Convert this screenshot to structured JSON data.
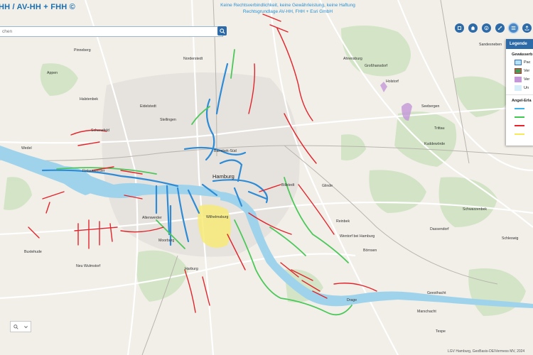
{
  "header": {
    "title": "HH / AV-HH + FHH ©",
    "disclaimer_line1": "Keine Rechtsverbindlichkeit, keine Gewährleistung, keine Haftung",
    "disclaimer_line2": "Rechtsgrundlage AV-HH, FHH + Esri GmbH"
  },
  "search": {
    "placeholder": "chen"
  },
  "toolbar": {
    "buttons": [
      "layers-icon",
      "home-icon",
      "info-icon",
      "share-icon",
      "legend-icon",
      "export-icon"
    ]
  },
  "legend": {
    "tab_label": "Legende",
    "section1_title": "Gewässerb",
    "section1_items": [
      {
        "label": "Pac",
        "color": "#b5e3f5",
        "border": "#3e6ea8"
      },
      {
        "label": "Ver",
        "color": "#3f9e5a",
        "border": "#c02a2a"
      },
      {
        "label": "Ver",
        "color": "#c497d8",
        "border": "#c497d8"
      },
      {
        "label": "Un",
        "color": "#d6eef9",
        "border": "#d6eef9"
      }
    ],
    "section2_title": "Angel-Erla",
    "section2_lines": [
      "#3bb3e8",
      "#40c94f",
      "#e8242a",
      "#f7ea5a"
    ]
  },
  "places": {
    "norderstedt": "Norderstedt",
    "appen": "Appen",
    "pinneberg": "Pinneberg",
    "ahrensburg": "Ahrensburg",
    "grosshansdorf": "Großhansdorf",
    "holstorf": "Holstorf",
    "sandesneben": "Sandesneben",
    "halstenbek": "Halstenbek",
    "schenefeld": "Schenefeld",
    "eidelstedt": "Eidelstedt",
    "stellingen": "Stellingen",
    "barmbek": "Barmbek-Süd",
    "wedel": "Wedel",
    "hamburg": "Hamburg",
    "billstedt": "Billstedt",
    "glinde": "Glinde",
    "trittau": "Trittau",
    "kuddewoerde": "Kuddewörde",
    "seebergen": "Seebergen",
    "finkenwerder": "Finkenwerder",
    "altenwerder": "Altenwerder",
    "moorburg": "Moorburg",
    "wilhelmsburg": "Wilhelmsburg",
    "reinbek": "Reinbek",
    "wentorf": "Wentorf bei Hamburg",
    "boernsen": "Börnsen",
    "dassendorf": "Dassendorf",
    "schwarzenbek": "Schwarzenbek",
    "buxtehude": "Buxtehude",
    "neu_wulmstorf": "Neu Wulmstorf",
    "harburg": "Harburg",
    "marschacht": "Marschacht",
    "tespe": "Tespe",
    "geesthacht": "Geesthacht",
    "drage": "Drage",
    "schleswig": "Schleswig"
  },
  "zoom": {
    "search_icon": "search-icon",
    "chevron": "chevron-down-icon"
  },
  "attribution": "LGV Hamburg, GeoBasis-DE/Vermess MV, 2024"
}
